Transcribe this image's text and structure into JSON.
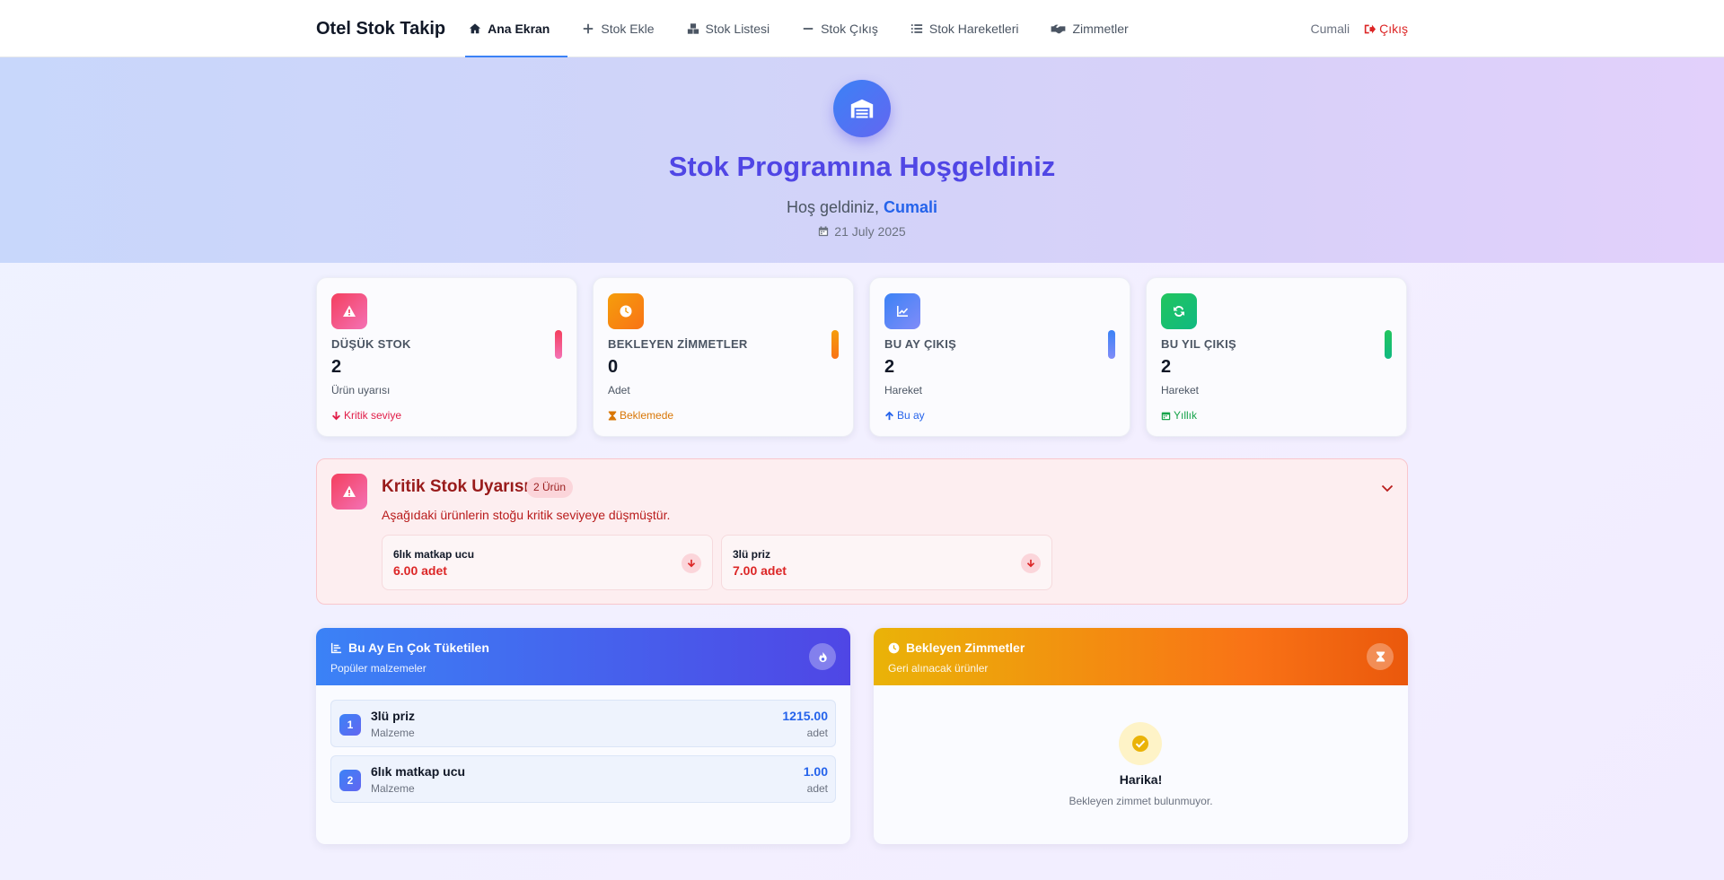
{
  "nav": {
    "brand": "Otel Stok Takip",
    "links": [
      {
        "label": "Ana Ekran",
        "icon": "home-icon",
        "active": true
      },
      {
        "label": "Stok Ekle",
        "icon": "plus-icon"
      },
      {
        "label": "Stok Listesi",
        "icon": "boxes-icon"
      },
      {
        "label": "Stok Çıkış",
        "icon": "minus-icon"
      },
      {
        "label": "Stok Hareketleri",
        "icon": "list-icon"
      },
      {
        "label": "Zimmetler",
        "icon": "handshake-icon"
      }
    ],
    "user": "Cumali",
    "logout": "Çıkış"
  },
  "hero": {
    "title": "Stok Programına Hoşgeldiniz",
    "welcome_prefix": "Hoş geldiniz,",
    "user": "Cumali",
    "date": "21 July 2025"
  },
  "stats": [
    {
      "label": "DÜŞÜK STOK",
      "value": "2",
      "sub": "Ürün uyarısı",
      "note": "Kritik seviye",
      "note_icon": "arrow-down-icon",
      "color": "#e11d48"
    },
    {
      "label": "BEKLEYEN ZİMMETLER",
      "value": "0",
      "sub": "Adet",
      "note": "Beklemede",
      "note_icon": "hourglass-icon",
      "color": "#d97706"
    },
    {
      "label": "BU AY ÇIKIŞ",
      "value": "2",
      "sub": "Hareket",
      "note": "Bu ay",
      "note_icon": "arrow-up-icon",
      "color": "#2563eb"
    },
    {
      "label": "BU YIL ÇIKIŞ",
      "value": "2",
      "sub": "Hareket",
      "note": "Yıllık",
      "note_icon": "calendar-icon",
      "color": "#16a34a"
    }
  ],
  "alert": {
    "title": "Kritik Stok Uyarısı",
    "badge": "2 Ürün",
    "description": "Aşağıdaki ürünlerin stoğu kritik seviyeye düşmüştür.",
    "items": [
      {
        "name": "6lık matkap ucu",
        "qty": "6.00 adet"
      },
      {
        "name": "3lü priz",
        "qty": "7.00 adet"
      }
    ]
  },
  "top_consumed": {
    "title": "Bu Ay En Çok Tüketilen",
    "subtitle": "Popüler malzemeler",
    "rows": [
      {
        "rank": "1",
        "name": "3lü priz",
        "type": "Malzeme",
        "amount": "1215.00",
        "unit": "adet"
      },
      {
        "rank": "2",
        "name": "6lık matkap ucu",
        "type": "Malzeme",
        "amount": "1.00",
        "unit": "adet"
      }
    ]
  },
  "pending": {
    "title": "Bekleyen Zimmetler",
    "subtitle": "Geri alınacak ürünler",
    "empty_title": "Harika!",
    "empty_desc": "Bekleyen zimmet bulunmuyor."
  }
}
